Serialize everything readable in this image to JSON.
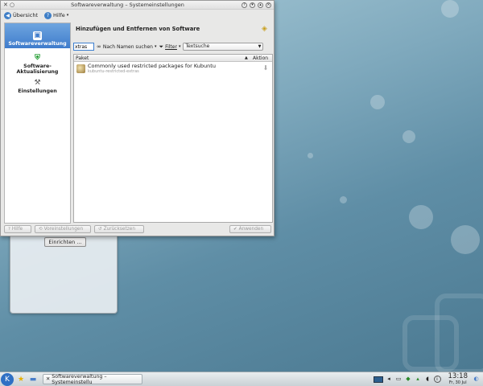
{
  "window": {
    "title": "Softwareverwaltung – Systemeinstellungen",
    "titlebar_icon": "tools-icon"
  },
  "toolbar": {
    "overview_label": "Übersicht",
    "help_label": "Hilfe"
  },
  "sidebar": {
    "items": [
      {
        "label": "Softwareverwaltung",
        "icon": "package-manager-icon",
        "active": true
      },
      {
        "label": "Software-\nAktualisierung",
        "icon": "shield-update-icon",
        "active": false
      },
      {
        "label": "Einstellungen",
        "icon": "tools-icon",
        "active": false
      }
    ]
  },
  "content": {
    "title": "Hinzufügen und Entfernen von Software",
    "search_value": "xtras",
    "search_mode_label": "Nach Namen suchen",
    "filter_label": "Filter",
    "text_search_label": "Textsuche"
  },
  "list": {
    "header_name": "Paket",
    "header_action": "Aktion",
    "rows": [
      {
        "name": "Commonly used restricted packages for Kubuntu",
        "sub": "kubuntu-restricted-extras"
      }
    ]
  },
  "buttons": {
    "help": "Hilfe",
    "defaults": "Voreinstellungen",
    "reset": "Zurücksetzen",
    "apply": "Anwenden"
  },
  "plasmoid": {
    "setup_label": "Einrichten ..."
  },
  "taskbar": {
    "task_label": "Softwareverwaltung – Systemeinstellu",
    "time": "13:18",
    "date": "Fr, 30 Jul"
  },
  "colors": {
    "accent": "#3f7ccc",
    "desktop": "#7fa9bd"
  }
}
